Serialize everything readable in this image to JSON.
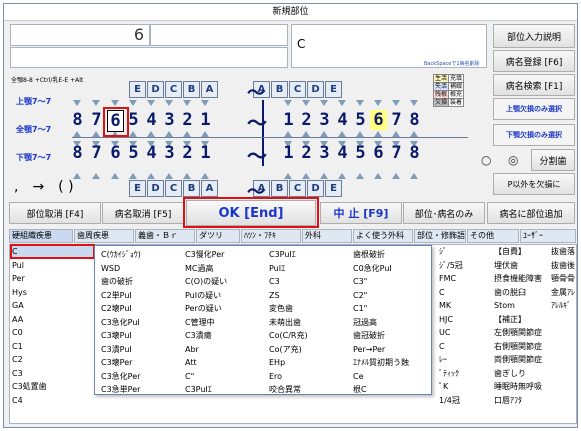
{
  "window": {
    "title": "新規部位"
  },
  "inputs": {
    "field1": "6",
    "field2": "",
    "field3": "C",
    "field4": "",
    "hint": "BackSpaceで1病名削除"
  },
  "right_buttons": {
    "b1": "部位入力説明",
    "b2": "病名登録 [F6]",
    "b3": "病名検索 [F1]",
    "b4": "上顎欠損のみ選択",
    "b5": "下顎欠損のみ選択",
    "radio_a": "○",
    "radio_b": "◎",
    "b6": "分割歯",
    "b7": "P以外を欠損に"
  },
  "shortcut_hint": "全顎8-8 +Ctrl/乳E-E +Alt",
  "jaw": {
    "upper": "上顎7～7",
    "full": "全顎7～7",
    "lower": "下顎7～7"
  },
  "legend": [
    [
      "生活",
      "充填"
    ],
    [
      "失活",
      "補綴"
    ],
    [
      "残根",
      "根充"
    ],
    [
      "欠損",
      "装着"
    ]
  ],
  "teeth": {
    "baby_left": [
      "E",
      "D",
      "C",
      "B",
      "A"
    ],
    "baby_right": [
      "A",
      "B",
      "C",
      "D",
      "E"
    ],
    "upper_left": [
      "8",
      "7",
      "6",
      "5",
      "4",
      "3",
      "2",
      "1"
    ],
    "upper_right": [
      "1",
      "2",
      "3",
      "4",
      "5",
      "6",
      "7",
      "8"
    ],
    "lower_left": [
      "8",
      "7",
      "6",
      "5",
      "4",
      "3",
      "2",
      "1"
    ],
    "lower_right": [
      "1",
      "2",
      "3",
      "4",
      "5",
      "6",
      "7",
      "8"
    ],
    "sep": "～"
  },
  "symbols": ",　→　( )",
  "actions": {
    "cancel_part": "部位取消 [F4]",
    "cancel_name": "病名取消 [F5]",
    "ok": "OK [End]",
    "stop": "中 止 [F9]",
    "part_only": "部位･病名のみ",
    "add_name": "病名に部位追加"
  },
  "tabs": [
    "硬組織疾患",
    "歯周疾患",
    "義歯・Ｂｒ",
    "ダツリ",
    "ﾊﾂﾝ・ﾌﾁｷ",
    "外科",
    "よく使う外科",
    "部位・修飾語",
    "その他",
    "ﾕｰｻﾞｰ"
  ],
  "left_list": [
    "C",
    "Pul",
    "Per",
    "Hys",
    "GA",
    "AA",
    "C0",
    "C1",
    "C2",
    "C3",
    "C3処置歯",
    "C4"
  ],
  "popup": [
    [
      "C(ｳｶｲｼﾞｮｳ)",
      "C3慢化Per",
      "C3PuIｴ",
      "歯根破折"
    ],
    [
      "WSD",
      "MC過高",
      "PuIｴ",
      "C0急化PuI"
    ],
    [
      "歯の破折",
      "C(O)の疑い",
      "C3",
      "C3\""
    ],
    [
      "C2単PuI",
      "PuIの疑い",
      "ZS",
      "C2\""
    ],
    [
      "C2壊PuI",
      "Perの疑い",
      "変色歯",
      "C1\""
    ],
    [
      "C3急化PuI",
      "C管理中",
      "未萌出歯",
      "冠過高"
    ],
    [
      "C3壊PuI",
      "C3潰瘍",
      "Co(C/R充)",
      "歯冠破折"
    ],
    [
      "C3潰PuI",
      "Abr",
      "Co(ア充)",
      "Per→Per"
    ],
    [
      "C3壊Per",
      "Att",
      "EHp",
      "ｴﾅﾒﾙ質初期う蝕"
    ],
    [
      "C3急化Per",
      "C\"",
      "Ero",
      "Ce"
    ],
    [
      "C3急単Per",
      "C3PuIｴ",
      "咬合異常",
      "根C"
    ]
  ],
  "mod_list": [
    "ｼﾞ",
    "ｼﾞ/5冠",
    "FMC",
    "C",
    "MK",
    "HJC",
    "UC",
    "C",
    "ﾚｰ",
    "ﾞﾃｨｯｸ",
    "ﾟK",
    "1/4冠"
  ],
  "other_list": [
    "【自費】",
    "埋伏歯",
    "摂食機能障害",
    "歯の脱臼",
    "Stom",
    "【補正】",
    "左側顎関節症",
    "右側顎関節症",
    "両側顎関節症",
    "歯ぎしり",
    "睡眠時無呼吸",
    "口唇ｱﾌﾀ"
  ],
  "user_list": [
    "抜歯落",
    "抜歯後",
    "顎骨骨",
    "金属ｱﾚ",
    "ｱﾚﾙｷﾞ"
  ]
}
